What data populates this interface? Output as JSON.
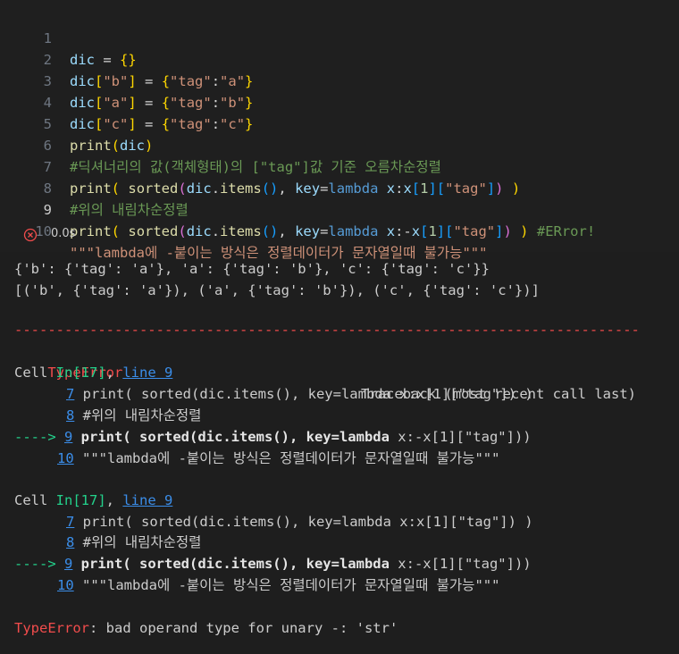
{
  "editor": {
    "lines": [
      {
        "num": "1"
      },
      {
        "num": "2"
      },
      {
        "num": "3"
      },
      {
        "num": "4"
      },
      {
        "num": "5"
      },
      {
        "num": "6",
        "comment": "#딕셔너리의 값(객체형태)의 [\"tag\"]값 기준 오름차순정렬"
      },
      {
        "num": "7"
      },
      {
        "num": "8",
        "comment": "#위의 내림차순정렬"
      },
      {
        "num": "9",
        "comment": "#ERror!"
      },
      {
        "num": "10",
        "docstring": "\"\"\"lambda에 -붙이는 방식은 정렬데이터가 문자열일때 불가능\"\"\""
      }
    ]
  },
  "status": {
    "time": "0.0s",
    "icon": "error-circle-icon",
    "color": "#f14c4c"
  },
  "output": {
    "result1": "{'b': {'tag': 'a'}, 'a': {'tag': 'b'}, 'c': {'tag': 'c'}}",
    "result2": "[('b', {'tag': 'a'}), ('a', {'tag': 'b'}), ('c', {'tag': 'c'})]",
    "separator": "---------------------------------------------------------------------------",
    "error_name": "TypeError",
    "traceback_label": "Traceback (most recent call last)",
    "frames": [
      {
        "cell_label": "Cell ",
        "in_label": "In[17]",
        "comma": ", ",
        "line_link": "line 9",
        "lines": [
          {
            "num": "7",
            "text": " print( sorted(dic.items(), key=lambda x:x[1][\"tag\"]) )"
          },
          {
            "num": "8",
            "text": " #위의 내림차순정렬"
          },
          {
            "arrow": "----> ",
            "num": "9",
            "bold": " print( sorted(dic.items(), key=lambda ",
            "rest": "x:-x[1][\"tag\"]))"
          },
          {
            "num": "10",
            "text": " \"\"\"lambda에 -붙이는 방식은 정렬데이터가 문자열일때 불가능\"\"\""
          }
        ]
      },
      {
        "cell_label": "Cell ",
        "in_label": "In[17]",
        "comma": ", ",
        "line_link": "line 9",
        "lines": [
          {
            "num": "7",
            "text": " print( sorted(dic.items(), key=lambda x:x[1][\"tag\"]) )"
          },
          {
            "num": "8",
            "text": " #위의 내림차순정렬"
          },
          {
            "arrow": "----> ",
            "num": "9",
            "bold": " print( sorted(dic.items(), key=lambda ",
            "rest": "x:-x[1][\"tag\"]))"
          },
          {
            "num": "10",
            "text": " \"\"\"lambda에 -붙이는 방식은 정렬데이터가 문자열일때 불가능\"\"\""
          }
        ]
      }
    ],
    "final_error_name": "TypeError",
    "final_error_msg": ": bad operand type for unary -: 'str'"
  }
}
